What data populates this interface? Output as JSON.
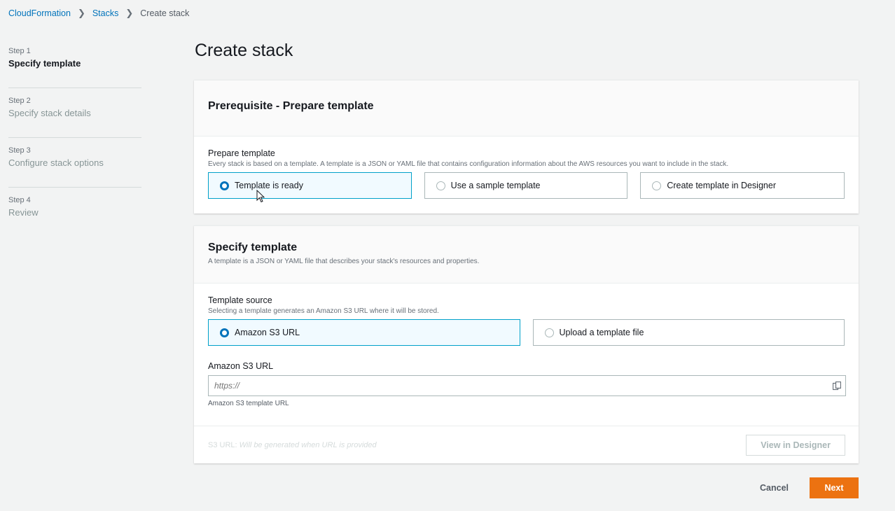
{
  "breadcrumb": {
    "items": [
      "CloudFormation",
      "Stacks",
      "Create stack"
    ]
  },
  "steps": [
    {
      "num": "Step 1",
      "label": "Specify template",
      "active": true
    },
    {
      "num": "Step 2",
      "label": "Specify stack details",
      "active": false
    },
    {
      "num": "Step 3",
      "label": "Configure stack options",
      "active": false
    },
    {
      "num": "Step 4",
      "label": "Review",
      "active": false
    }
  ],
  "page_title": "Create stack",
  "prereq": {
    "heading": "Prerequisite - Prepare template",
    "field_label": "Prepare template",
    "field_desc": "Every stack is based on a template. A template is a JSON or YAML file that contains configuration information about the AWS resources you want to include in the stack.",
    "options": [
      {
        "label": "Template is ready",
        "selected": true
      },
      {
        "label": "Use a sample template",
        "selected": false
      },
      {
        "label": "Create template in Designer",
        "selected": false
      }
    ]
  },
  "specify": {
    "heading": "Specify template",
    "desc": "A template is a JSON or YAML file that describes your stack's resources and properties.",
    "source_label": "Template source",
    "source_desc": "Selecting a template generates an Amazon S3 URL where it will be stored.",
    "sources": [
      {
        "label": "Amazon S3 URL",
        "selected": true
      },
      {
        "label": "Upload a template file",
        "selected": false
      }
    ],
    "url_label": "Amazon S3 URL",
    "url_placeholder": "https://",
    "url_hint": "Amazon S3 template URL",
    "s3_label": "S3 URL:",
    "s3_value": "Will be generated when URL is provided",
    "view_designer_label": "View in Designer"
  },
  "actions": {
    "cancel_label": "Cancel",
    "next_label": "Next"
  },
  "colors": {
    "accent": "#0073bb",
    "primary_button": "#ec7211",
    "selected_tile_bg": "#f1faff"
  }
}
